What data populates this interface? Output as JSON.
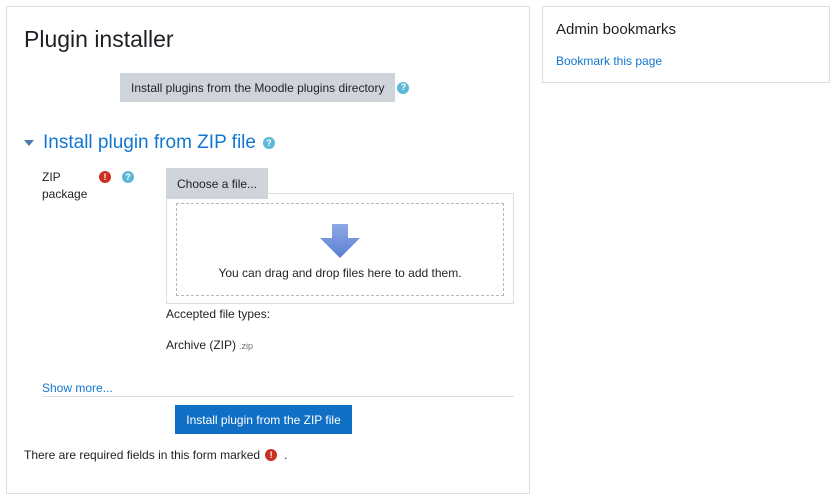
{
  "page": {
    "title": "Plugin installer",
    "install_directory_button": "Install plugins from the Moodle plugins directory"
  },
  "zip_section": {
    "title": "Install plugin from ZIP file",
    "field_label": "ZIP package",
    "choose_file_button": "Choose a file...",
    "dropzone_text": "You can drag and drop files here to add them.",
    "accepted_label": "Accepted file types:",
    "accepted_type": "Archive (ZIP)",
    "accepted_ext": ".zip",
    "show_more": "Show more...",
    "submit_button": "Install plugin from the ZIP file"
  },
  "required_note": {
    "text": "There are required fields in this form marked",
    "suffix": "."
  },
  "sidebar": {
    "title": "Admin bookmarks",
    "link": "Bookmark this page"
  },
  "icons": {
    "help": "?",
    "required": "!"
  },
  "colors": {
    "link": "#1177d1",
    "primary": "#0f6fc5",
    "secondary_button": "#ced4da",
    "required": "#ca3120",
    "help": "#5bb8d9"
  }
}
